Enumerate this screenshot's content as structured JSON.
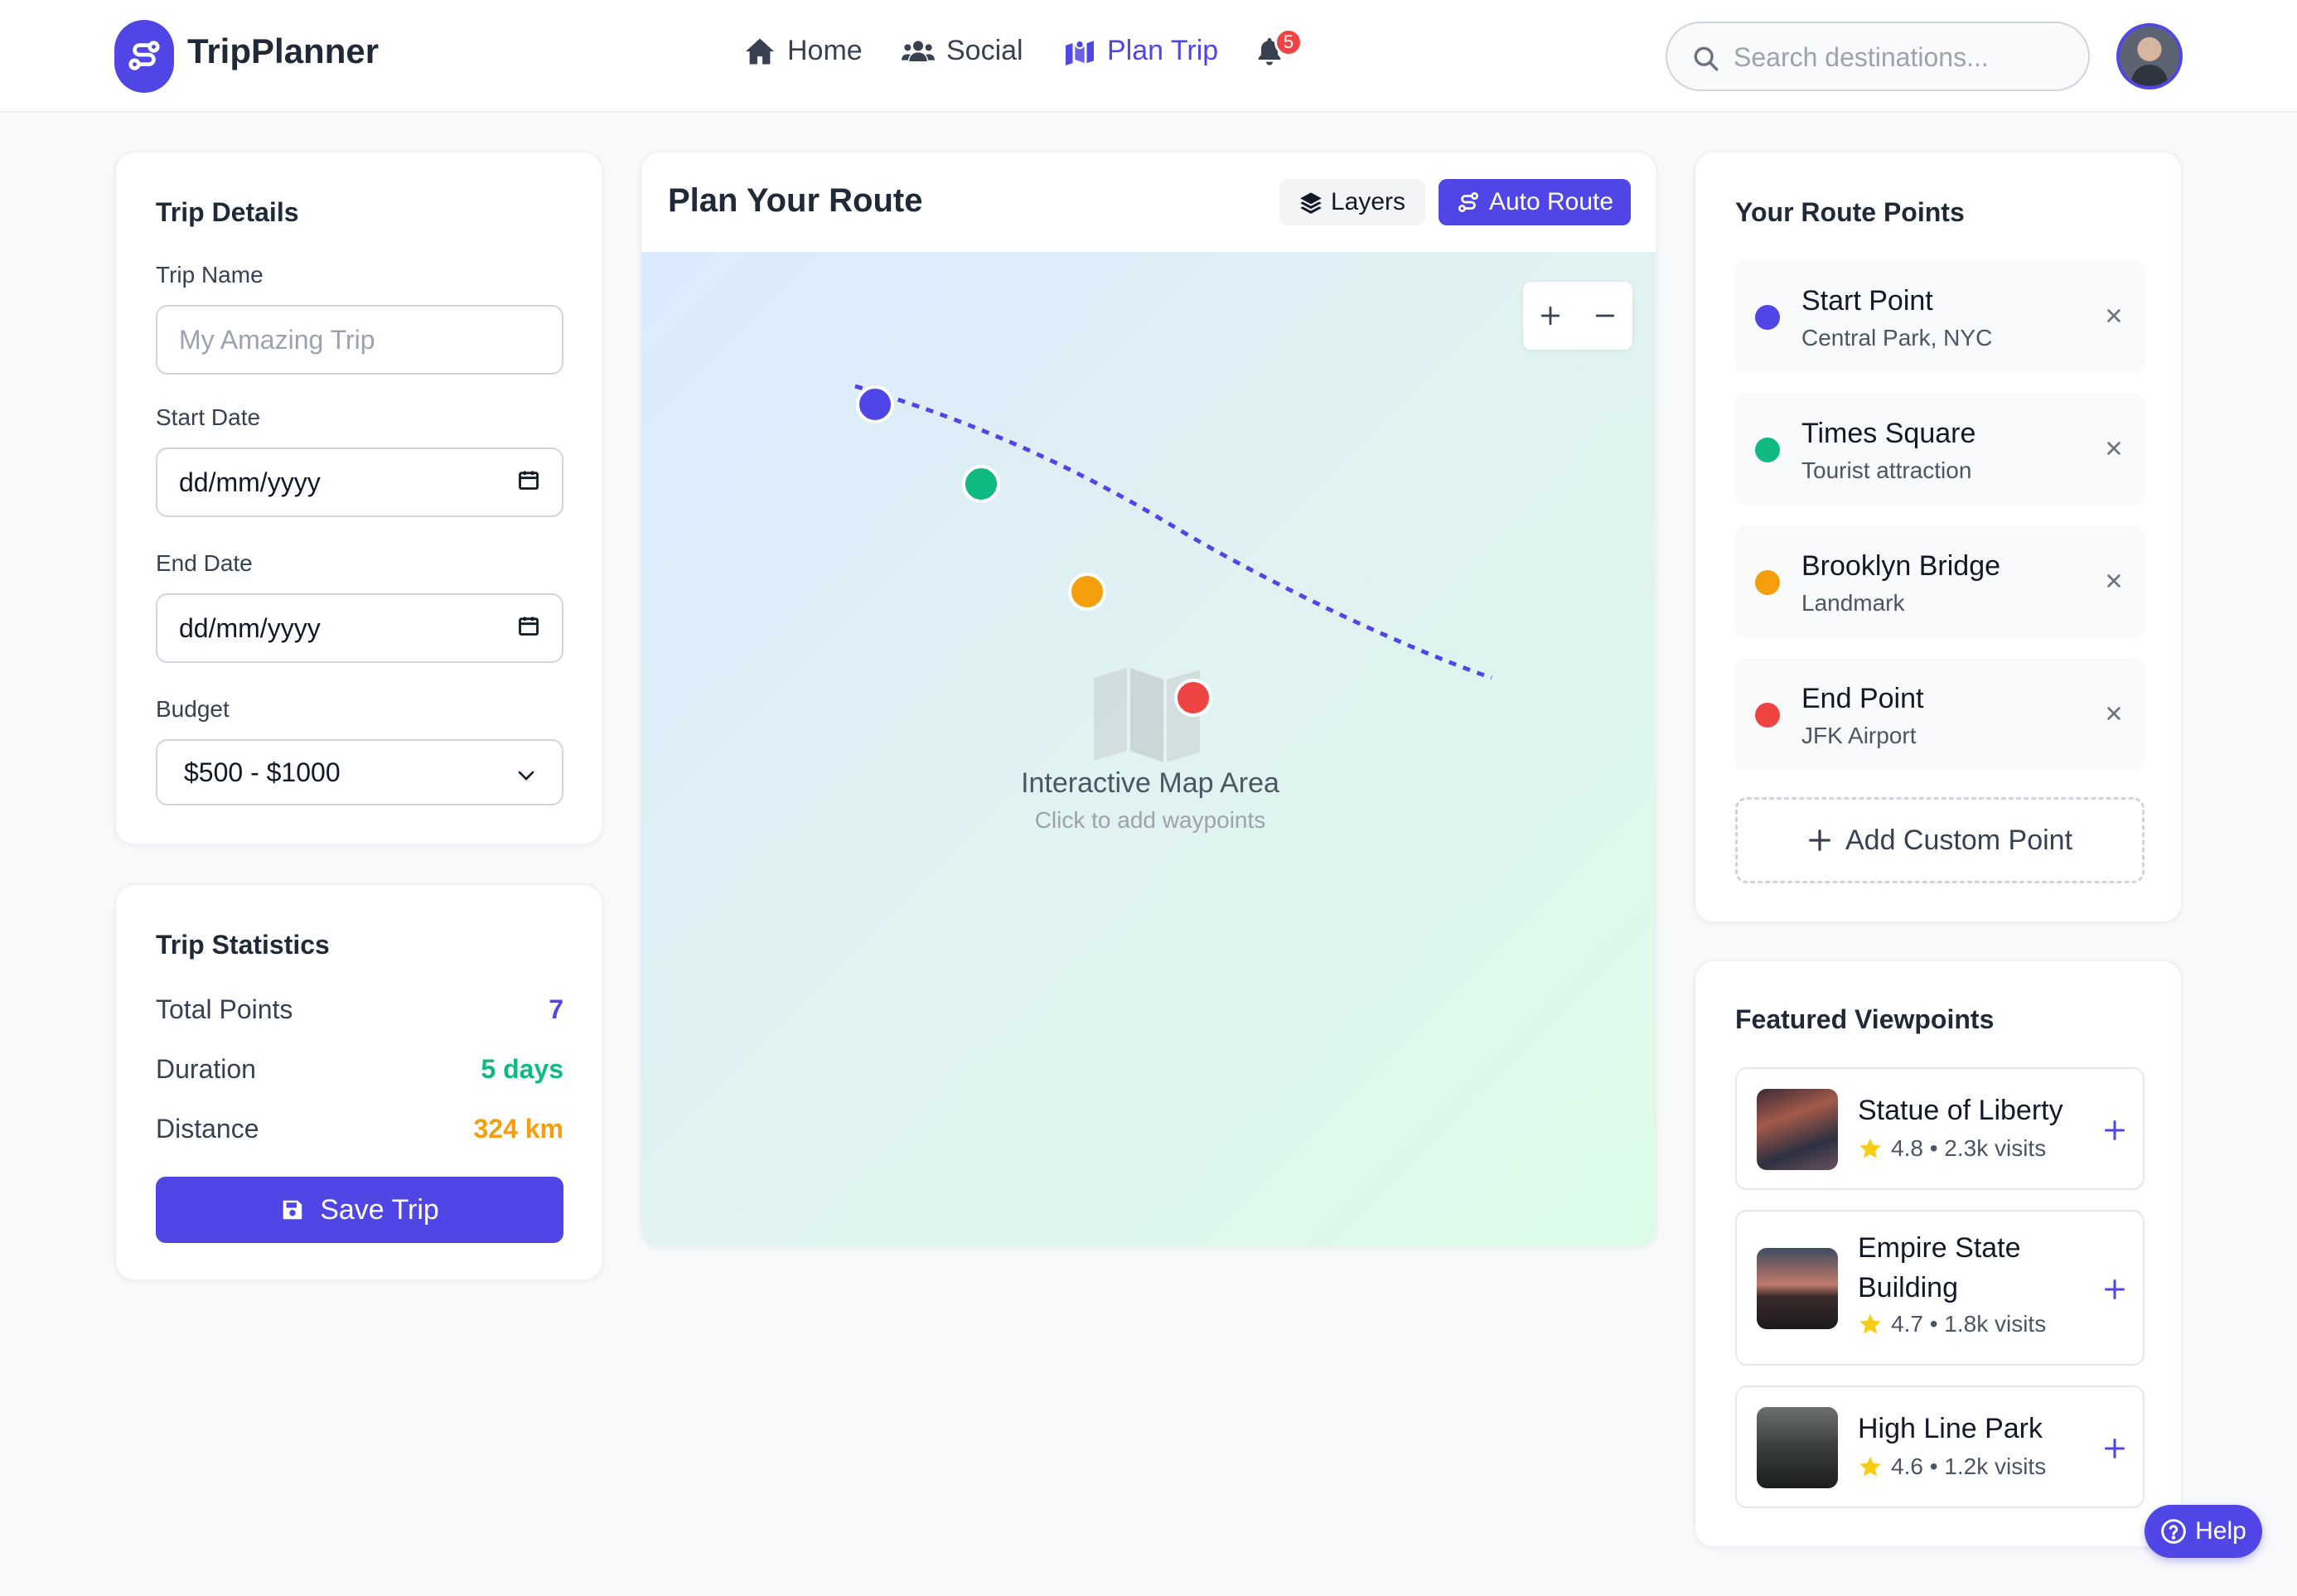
{
  "app": {
    "title": "TripPlanner"
  },
  "nav": {
    "home": "Home",
    "social": "Social",
    "plan_trip": "Plan Trip",
    "notification_count": "5"
  },
  "search": {
    "placeholder": "Search destinations..."
  },
  "trip_details": {
    "title": "Trip Details",
    "trip_name_label": "Trip Name",
    "trip_name_placeholder": "My Amazing Trip",
    "start_date_label": "Start Date",
    "start_date_value": "dd/mm/yyyy",
    "end_date_label": "End Date",
    "end_date_value": "dd/mm/yyyy",
    "budget_label": "Budget",
    "budget_value": "$500 - $1000"
  },
  "trip_statistics": {
    "title": "Trip Statistics",
    "rows": [
      {
        "label": "Total Points",
        "value": "7",
        "color": "#4f46e5"
      },
      {
        "label": "Duration",
        "value": "5 days",
        "color": "#10b981"
      },
      {
        "label": "Distance",
        "value": "324 km",
        "color": "#f59e0b"
      }
    ],
    "save_label": "Save Trip"
  },
  "map": {
    "title": "Plan Your Route",
    "layers_label": "Layers",
    "auto_route_label": "Auto Route",
    "caption": "Interactive Map Area",
    "subcaption": "Click to add waypoints",
    "markers": [
      {
        "name": "start",
        "color": "#4f46e5"
      },
      {
        "name": "waypoint-1",
        "color": "#10b981"
      },
      {
        "name": "waypoint-2",
        "color": "#f59e0b"
      },
      {
        "name": "end",
        "color": "#ef4444"
      }
    ]
  },
  "route_points": {
    "title": "Your Route Points",
    "items": [
      {
        "name": "Start Point",
        "desc": "Central Park, NYC",
        "color": "#4f46e5"
      },
      {
        "name": "Times Square",
        "desc": "Tourist attraction",
        "color": "#10b981"
      },
      {
        "name": "Brooklyn Bridge",
        "desc": "Landmark",
        "color": "#f59e0b"
      },
      {
        "name": "End Point",
        "desc": "JFK Airport",
        "color": "#ef4444"
      }
    ],
    "add_label": "Add Custom Point"
  },
  "viewpoints": {
    "title": "Featured Viewpoints",
    "items": [
      {
        "name": "Statue of Liberty",
        "rating": "4.8",
        "visits": "2.3k visits",
        "meta": "4.8 • 2.3k visits"
      },
      {
        "name": "Empire State Building",
        "rating": "4.7",
        "visits": "1.8k visits",
        "meta": "4.7 • 1.8k visits"
      },
      {
        "name": "High Line Park",
        "rating": "4.6",
        "visits": "1.2k visits",
        "meta": "4.6 • 1.2k visits"
      }
    ]
  },
  "help": {
    "label": "Help"
  },
  "colors": {
    "accent": "#4f46e5",
    "green": "#10b981",
    "orange": "#f59e0b",
    "red": "#ef4444"
  }
}
